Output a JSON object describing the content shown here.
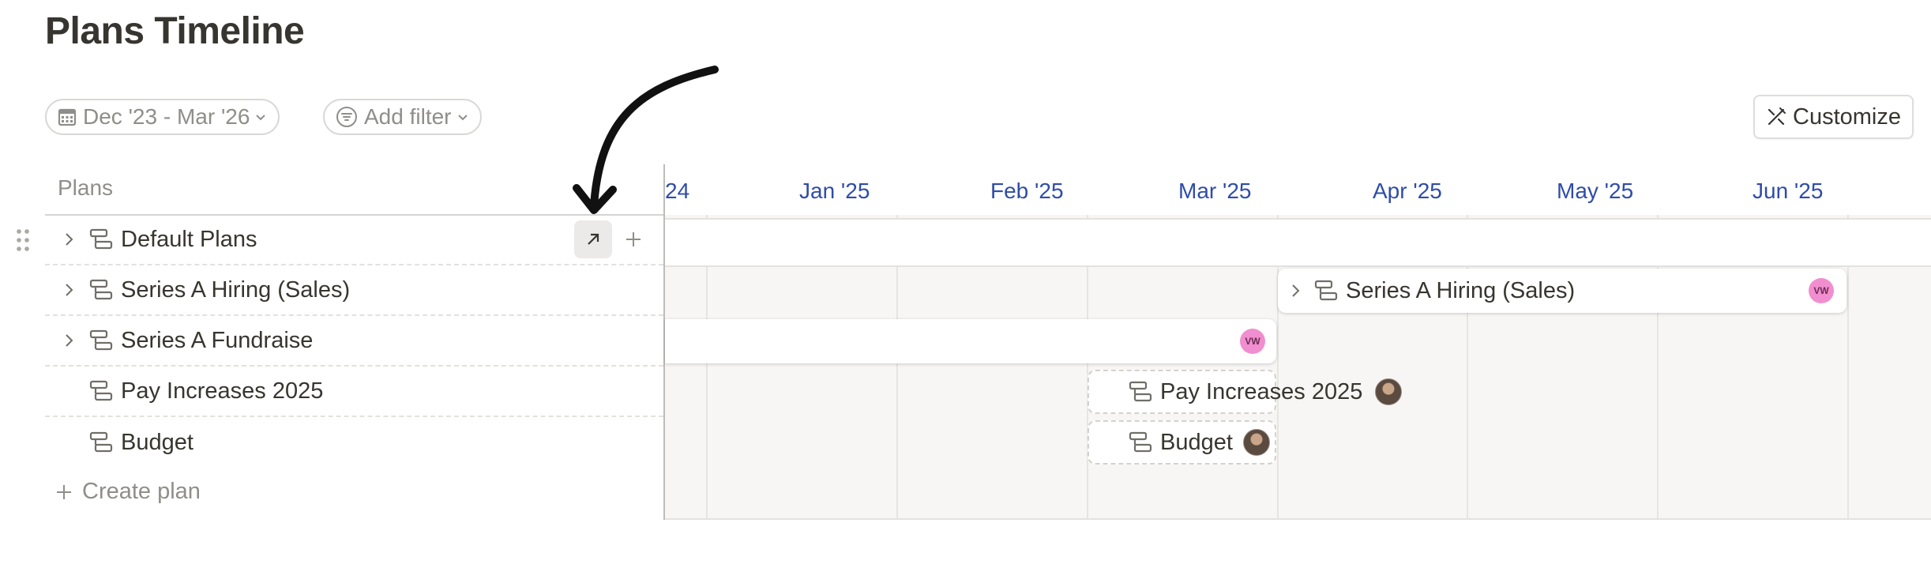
{
  "page": {
    "title": "Plans Timeline"
  },
  "toolbar": {
    "date_range": "Dec '23 - Mar '26",
    "add_filter": "Add filter",
    "customize": "Customize"
  },
  "sidebar": {
    "header": "Plans",
    "rows": [
      {
        "label": "Default Plans",
        "expandable": true
      },
      {
        "label": "Series A Hiring (Sales)",
        "expandable": true
      },
      {
        "label": "Series A Fundraise",
        "expandable": true
      },
      {
        "label": "Pay Increases 2025",
        "expandable": false
      },
      {
        "label": "Budget",
        "expandable": false
      }
    ],
    "create_label": "Create plan"
  },
  "timeline": {
    "months": [
      "24",
      "Jan '25",
      "Feb '25",
      "Mar '25",
      "Apr '25",
      "May '25",
      "Jun '25"
    ],
    "bars": {
      "hiring": {
        "label": "Series A Hiring (Sales)",
        "avatar": "VW"
      },
      "fundraise": {
        "avatar": "VW"
      },
      "pay": {
        "label": "Pay Increases 2025"
      },
      "budget": {
        "label": "Budget"
      }
    }
  },
  "colors": {
    "month_text": "#2f4ca8",
    "avatar_pink": "#f18ecf",
    "grid_bg": "#f7f6f4"
  },
  "icons": [
    "calendar-icon",
    "filter-icon",
    "chevron-down-icon",
    "customize-icon",
    "drag-handle-icon",
    "chevron-right-icon",
    "plan-icon",
    "open-arrow-icon",
    "plus-icon",
    "annotation-arrow-icon"
  ]
}
